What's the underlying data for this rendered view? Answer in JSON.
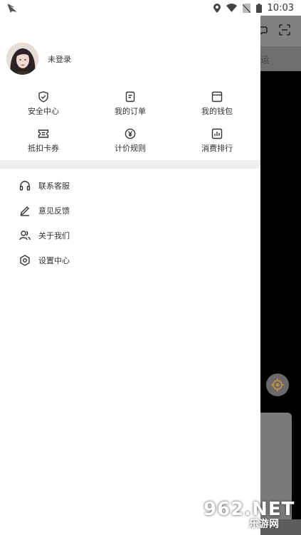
{
  "status_bar": {
    "time": "10:03"
  },
  "background": {
    "tab_fragment": "运"
  },
  "profile": {
    "name": "未登录"
  },
  "grid": {
    "rows": [
      [
        {
          "icon": "shield-icon",
          "label": "安全中心"
        },
        {
          "icon": "order-icon",
          "label": "我的订单"
        },
        {
          "icon": "wallet-icon",
          "label": "我的钱包"
        }
      ],
      [
        {
          "icon": "coupon-icon",
          "label": "抵扣卡券"
        },
        {
          "icon": "yuan-icon",
          "label": "计价规则"
        },
        {
          "icon": "ranking-icon",
          "label": "消费排行"
        }
      ]
    ]
  },
  "menu": {
    "items": [
      {
        "icon": "headset-icon",
        "label": "联系客服"
      },
      {
        "icon": "pencil-icon",
        "label": "意见反馈"
      },
      {
        "icon": "people-icon",
        "label": "关于我们"
      },
      {
        "icon": "settings-icon",
        "label": "设置中心"
      }
    ]
  },
  "watermark": {
    "top": "962.NET",
    "bottom": "乐游网"
  }
}
